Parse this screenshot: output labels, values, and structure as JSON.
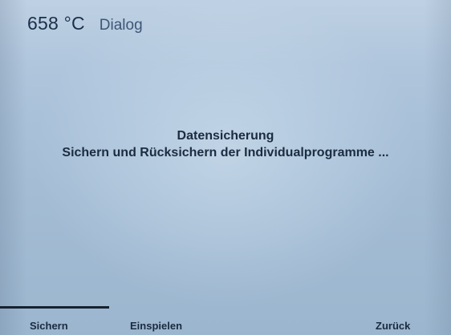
{
  "header": {
    "temperature": "658 °C",
    "title": "Dialog"
  },
  "message": {
    "heading": "Datensicherung",
    "description": "Sichern und Rücksichern der Individualprogramme ..."
  },
  "softkeys": [
    {
      "label": "Sichern",
      "selected": true
    },
    {
      "label": "Einspielen",
      "selected": false
    },
    {
      "label": "Zurück",
      "selected": false
    }
  ]
}
